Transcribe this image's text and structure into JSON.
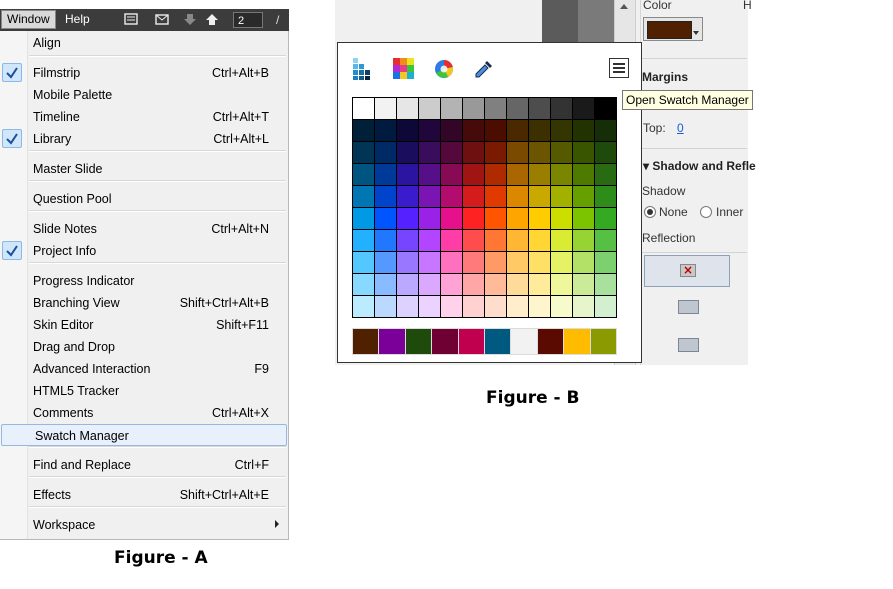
{
  "figure_a": {
    "menubar": {
      "window": "Window",
      "help": "Help",
      "page_number": "2",
      "page_sep": "/"
    },
    "menu": [
      {
        "label": "Align",
        "shortcut": "",
        "checked": false
      },
      {
        "label": "Filmstrip",
        "shortcut": "Ctrl+Alt+B",
        "checked": true
      },
      {
        "label": "Mobile Palette",
        "shortcut": "",
        "checked": false
      },
      {
        "label": "Timeline",
        "shortcut": "Ctrl+Alt+T",
        "checked": false
      },
      {
        "label": "Library",
        "shortcut": "Ctrl+Alt+L",
        "checked": true
      },
      {
        "label": "Master Slide",
        "shortcut": "",
        "checked": false
      },
      {
        "label": "Question Pool",
        "shortcut": "",
        "checked": false
      },
      {
        "label": "Slide Notes",
        "shortcut": "Ctrl+Alt+N",
        "checked": false
      },
      {
        "label": "Project Info",
        "shortcut": "",
        "checked": true
      },
      {
        "label": "Progress Indicator",
        "shortcut": "",
        "checked": false
      },
      {
        "label": "Branching View",
        "shortcut": "Shift+Ctrl+Alt+B",
        "checked": false
      },
      {
        "label": "Skin Editor",
        "shortcut": "Shift+F11",
        "checked": false
      },
      {
        "label": "Drag and Drop",
        "shortcut": "",
        "checked": false
      },
      {
        "label": "Advanced Interaction",
        "shortcut": "F9",
        "checked": false
      },
      {
        "label": "HTML5 Tracker",
        "shortcut": "",
        "checked": false
      },
      {
        "label": "Comments",
        "shortcut": "Ctrl+Alt+X",
        "checked": false
      },
      {
        "label": "Swatch Manager",
        "shortcut": "",
        "checked": false,
        "highlighted": true
      },
      {
        "label": "Find and Replace",
        "shortcut": "Ctrl+F",
        "checked": false
      },
      {
        "label": "Effects",
        "shortcut": "Shift+Ctrl+Alt+E",
        "checked": false
      },
      {
        "label": "Workspace",
        "shortcut": "",
        "checked": false,
        "submenu": true
      }
    ],
    "caption": "Figure - A"
  },
  "figure_b": {
    "props": {
      "color_label": "Color",
      "cut_label": "H",
      "margins": "Margins",
      "top_label": "Top:",
      "top_value": "0",
      "shadow_section": "Shadow and Refle",
      "shadow_label": "Shadow",
      "shadow_none": "None",
      "shadow_inner": "Inner",
      "reflection_label": "Reflection",
      "selected_color": "#4f2100"
    },
    "tooltip": "Open Swatch Manager",
    "toolbar_icons": [
      "swatches-icon",
      "color-grid-icon",
      "color-wheel-icon",
      "eyedropper-icon",
      "menu-icon"
    ],
    "swatch_grid": [
      [
        "#ffffff",
        "#f2f2f2",
        "#e6e6e6",
        "#cccccc",
        "#b3b3b3",
        "#999999",
        "#808080",
        "#666666",
        "#4d4d4d",
        "#333333",
        "#1a1a1a",
        "#000000"
      ],
      [
        "#00203a",
        "#001a40",
        "#0e0838",
        "#20063a",
        "#330526",
        "#460a0a",
        "#4a0d00",
        "#4a2800",
        "#3c3000",
        "#333600",
        "#223300",
        "#162e08"
      ],
      [
        "#003555",
        "#002a66",
        "#1a0d5e",
        "#3a0c5c",
        "#55083c",
        "#6e1010",
        "#7a1a00",
        "#7a4a00",
        "#6b5500",
        "#555a00",
        "#3a5500",
        "#1e4a0c"
      ],
      [
        "#005580",
        "#003a99",
        "#2a14a0",
        "#550f88",
        "#880a55",
        "#a01414",
        "#b02a00",
        "#aa6600",
        "#9a7e00",
        "#7a8500",
        "#4e7a00",
        "#286b12"
      ],
      [
        "#0077b3",
        "#0044cc",
        "#3a1ccc",
        "#7a14b3",
        "#b30c6e",
        "#d41c1c",
        "#e03a00",
        "#d98800",
        "#c9a800",
        "#a2b000",
        "#66a000",
        "#2e8c1a"
      ],
      [
        "#0099e6",
        "#0055ff",
        "#5522ff",
        "#9922e6",
        "#e6108c",
        "#ff2222",
        "#ff5500",
        "#ffa500",
        "#ffcc00",
        "#ccdd00",
        "#7cc400",
        "#33aa22"
      ],
      [
        "#22b0ff",
        "#2277ff",
        "#7744ff",
        "#b344ff",
        "#ff3da6",
        "#ff4d4d",
        "#ff7733",
        "#ffb733",
        "#ffd633",
        "#d9ec33",
        "#96d433",
        "#55c044"
      ],
      [
        "#55c7ff",
        "#5599ff",
        "#9977ff",
        "#c777ff",
        "#ff70bf",
        "#ff7a7a",
        "#ff9966",
        "#ffc966",
        "#ffe066",
        "#e6f266",
        "#b3e066",
        "#7dd06e"
      ],
      [
        "#88d9ff",
        "#88bbff",
        "#bba8ff",
        "#dba8ff",
        "#ffa3d6",
        "#ffa6a6",
        "#ffbb99",
        "#ffdb99",
        "#ffeb99",
        "#eef799",
        "#cceb99",
        "#a8e09e"
      ],
      [
        "#bbebff",
        "#bbd9ff",
        "#ddd2ff",
        "#ecd2ff",
        "#ffd1ea",
        "#ffd1d1",
        "#ffddcc",
        "#ffedcc",
        "#fff5cc",
        "#f7fbcc",
        "#e6f5cc",
        "#d2efcf"
      ]
    ],
    "recent_swatches": [
      "#4f2100",
      "#7a0099",
      "#1e4a0c",
      "#6e0033",
      "#c0004e",
      "#005a80",
      "#f2f2f2",
      "#5a0a00",
      "#ffbb00",
      "#8a9a00"
    ],
    "caption": "Figure - B"
  }
}
